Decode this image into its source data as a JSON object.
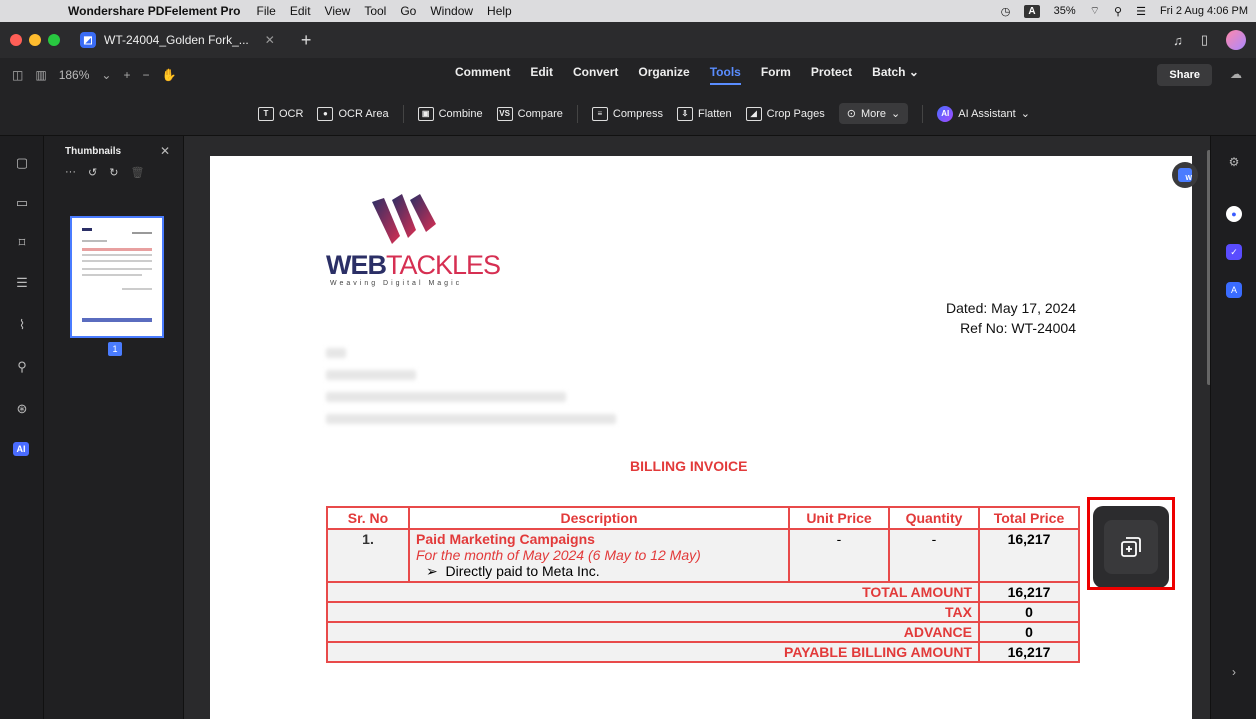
{
  "system_menubar": {
    "app_name": "Wondershare PDFelement Pro",
    "menus": [
      "File",
      "Edit",
      "View",
      "Tool",
      "Go",
      "Window",
      "Help"
    ],
    "battery": "35%",
    "input_badge": "A",
    "datetime": "Fri 2 Aug  4:06 PM"
  },
  "tab": {
    "title": "WT-24004_Golden Fork_..."
  },
  "toolbar": {
    "zoom": "186%",
    "menus": [
      "Comment",
      "Edit",
      "Convert",
      "Organize",
      "Tools",
      "Form",
      "Protect",
      "Batch"
    ],
    "active_menu": "Tools",
    "share_label": "Share",
    "tools": [
      {
        "label": "OCR",
        "icon": "ocr-icon"
      },
      {
        "label": "OCR Area",
        "icon": "ocr-area-icon"
      },
      {
        "label": "Combine",
        "icon": "combine-icon"
      },
      {
        "label": "Compare",
        "icon": "compare-icon"
      },
      {
        "label": "Compress",
        "icon": "compress-icon"
      },
      {
        "label": "Flatten",
        "icon": "flatten-icon"
      },
      {
        "label": "Crop Pages",
        "icon": "crop-icon"
      },
      {
        "label": "More",
        "icon": "more-icon"
      },
      {
        "label": "AI Assistant",
        "icon": "ai-icon"
      }
    ]
  },
  "thumbnails": {
    "title": "Thumbnails",
    "page_number": "1"
  },
  "document": {
    "brand_web": "WEB",
    "brand_tackles": "TACKLES",
    "tagline": "Weaving Digital Magic",
    "dated": "Dated: May 17, 2024",
    "ref": "Ref No: WT-24004",
    "heading": "BILLING INVOICE",
    "table": {
      "headers": [
        "Sr. No",
        "Description",
        "Unit Price",
        "Quantity",
        "Total Price"
      ],
      "row": {
        "sr": "1.",
        "title": "Paid Marketing Campaigns",
        "subtitle": "For the month of May 2024 (6 May to 12 May)",
        "bullet": "Directly paid to Meta Inc.",
        "unit_price": "-",
        "quantity": "-",
        "total": "16,217"
      },
      "summary": [
        {
          "label": "TOTAL AMOUNT",
          "value": "16,217"
        },
        {
          "label": "TAX",
          "value": "0"
        },
        {
          "label": "ADVANCE",
          "value": "0"
        },
        {
          "label": "PAYABLE BILLING AMOUNT",
          "value": "16,217"
        }
      ]
    }
  },
  "colors": {
    "accent": "#4a7cff",
    "invoice_red": "#e23a3a",
    "highlight": "#e00000"
  }
}
